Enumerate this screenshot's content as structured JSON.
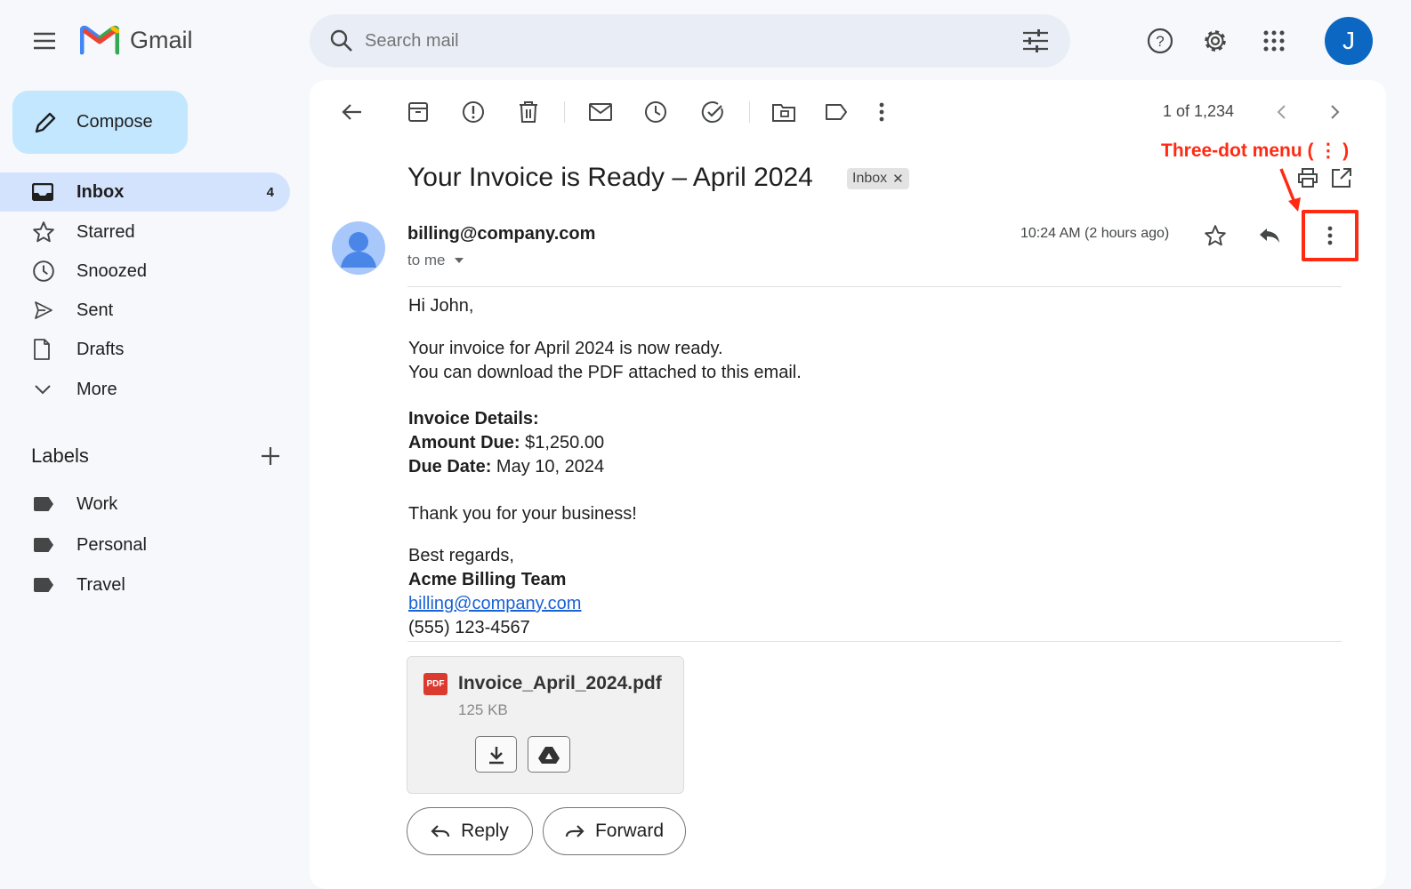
{
  "app": {
    "name": "Gmail"
  },
  "search": {
    "placeholder": "Search mail"
  },
  "account": {
    "initial": "J"
  },
  "sidebar": {
    "compose": "Compose",
    "items": [
      {
        "label": "Inbox",
        "count": "4"
      },
      {
        "label": "Starred"
      },
      {
        "label": "Snoozed"
      },
      {
        "label": "Sent"
      },
      {
        "label": "Drafts"
      },
      {
        "label": "More"
      }
    ],
    "labels_heading": "Labels",
    "labels": [
      "Work",
      "Personal",
      "Travel"
    ]
  },
  "toolbar": {
    "pagination": "1 of 1,234"
  },
  "email": {
    "subject": "Your Invoice is Ready – April 2024",
    "badge": "Inbox",
    "sender": "billing@company.com",
    "recipient": "to me",
    "time": "10:24 AM (2 hours ago)",
    "greeting": "Hi John,",
    "line1": "Your invoice for April 2024 is now ready.",
    "line2": "You can download the PDF attached to this email.",
    "details_heading": "Invoice Details:",
    "amount_label": "Amount Due:",
    "amount_value": " $1,250.00",
    "due_label": "Due Date:",
    "due_value": " May 10, 2024",
    "thanks": "Thank you for your business!",
    "closing": "Best regards,",
    "team": "Acme Billing Team",
    "link": "billing@company.com",
    "phone": "(555) 123-4567"
  },
  "attachment": {
    "type_badge": "PDF",
    "filename": "Invoice_April_2024.pdf",
    "size": "125 KB"
  },
  "actions": {
    "reply": "Reply",
    "forward": "Forward"
  },
  "annotation": {
    "text": "Three-dot menu ( ⋮ )",
    "color": "#ff2a12"
  }
}
